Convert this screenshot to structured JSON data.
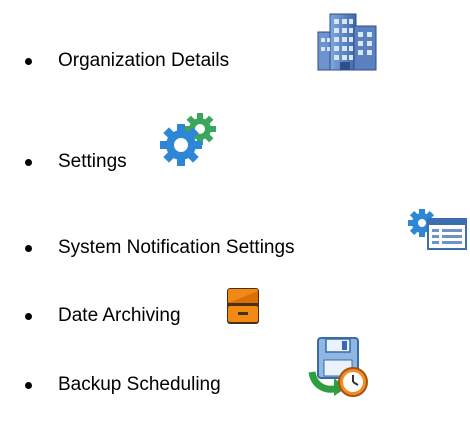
{
  "items": [
    {
      "label": "Organization Details",
      "icon": "office-building-icon"
    },
    {
      "label": "Settings",
      "icon": "gears-icon"
    },
    {
      "label": "System Notification Settings",
      "icon": "settings-window-icon"
    },
    {
      "label": "Date Archiving",
      "icon": "archive-drawer-icon"
    },
    {
      "label": "Backup Scheduling",
      "icon": "backup-schedule-icon"
    }
  ],
  "colors": {
    "bullet": "#000000",
    "text": "#000000",
    "building": "#5b84c4",
    "gear_blue": "#2e86d6",
    "gear_green": "#3aa55b",
    "drawer_orange": "#e97d10",
    "drawer_brown": "#4a2f16"
  }
}
